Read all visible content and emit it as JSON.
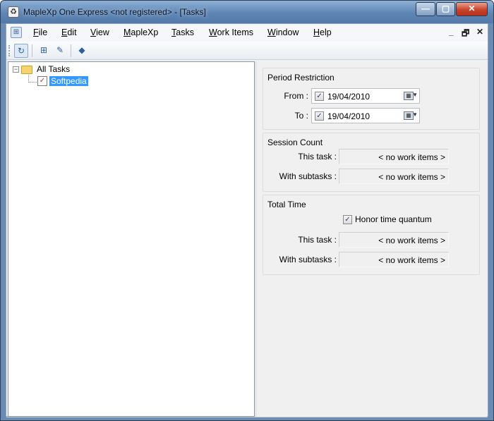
{
  "window": {
    "title": "MapleXp One Express <not registered> - [Tasks]",
    "app_icon_glyph": "♻",
    "controls": {
      "minimize": "—",
      "maximize": "▢",
      "close": "✕"
    }
  },
  "menubar": {
    "items": [
      "File",
      "Edit",
      "View",
      "MapleXp",
      "Tasks",
      "Work Items",
      "Window",
      "Help"
    ],
    "mdi": {
      "minimize": "_",
      "restore": "🗗",
      "close": "✕"
    }
  },
  "toolbar": {
    "buttons": [
      {
        "icon": "refresh-icon",
        "glyph": "↻"
      },
      {
        "icon": "task-tree-icon",
        "glyph": "⊞"
      },
      {
        "icon": "edit-icon",
        "glyph": "✎"
      },
      {
        "icon": "book-icon",
        "glyph": "◆"
      }
    ]
  },
  "tree": {
    "root": {
      "label": "All Tasks",
      "expander": "−"
    },
    "child": {
      "label": "Softpedia",
      "icon_glyph": "✓"
    }
  },
  "period_restriction": {
    "title": "Period Restriction",
    "from_label": "From :",
    "to_label": "To :",
    "from_value": "19/04/2010",
    "to_value": "19/04/2010",
    "from_checked": "✓",
    "to_checked": "✓",
    "cal_glyph": "▦",
    "dd_glyph": "▼"
  },
  "session_count": {
    "title": "Session Count",
    "this_task_label": "This task :",
    "with_subtasks_label": "With subtasks :",
    "this_task_value": "< no work items >",
    "with_subtasks_value": "< no work items >"
  },
  "total_time": {
    "title": "Total Time",
    "honor_label": "Honor time quantum",
    "honor_checked": "✓",
    "this_task_label": "This task :",
    "with_subtasks_label": "With subtasks :",
    "this_task_value": "< no work items >",
    "with_subtasks_value": "< no work items >"
  }
}
